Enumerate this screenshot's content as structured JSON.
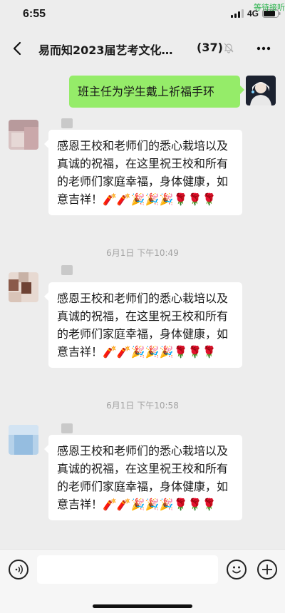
{
  "status_bar": {
    "time": "6:55",
    "network": "4G",
    "overlay_text": "等待接听"
  },
  "nav": {
    "back_icon": "chevron-left-icon",
    "title": "易而知2023届艺考文化…",
    "member_count": "(37)",
    "mute_icon": "bell-muted-icon",
    "more_icon": "more-dots-icon"
  },
  "messages": [
    {
      "type": "outgoing",
      "text": "班主任为学生戴上祈福手环"
    },
    {
      "type": "incoming",
      "text": "感恩王校和老师们的悉心栽培以及真诚的祝福，在这里祝王校和所有的老师们家庭幸福，身体健康，如意吉祥！🧨🧨🎉🎉🎉🌹🌹🌹"
    },
    {
      "type": "timestamp",
      "text": "6月1日 下午10:49"
    },
    {
      "type": "incoming",
      "text": "感恩王校和老师们的悉心栽培以及真诚的祝福，在这里祝王校和所有的老师们家庭幸福，身体健康，如意吉祥！🧨🧨🎉🎉🎉🌹🌹🌹"
    },
    {
      "type": "timestamp",
      "text": "6月1日 下午10:58"
    },
    {
      "type": "incoming",
      "text": "感恩王校和老师们的悉心栽培以及真诚的祝福，在这里祝王校和所有的老师们家庭幸福，身体健康，如意吉祥！🧨🧨🎉🎉🎉🌹🌹🌹"
    }
  ],
  "input_bar": {
    "voice_icon": "voice-icon",
    "emoji_icon": "emoji-icon",
    "plus_icon": "plus-icon",
    "placeholder": ""
  },
  "colors": {
    "background": "#ededed",
    "outgoing_bubble": "#95ec69",
    "incoming_bubble": "#ffffff",
    "overlay_green": "#2bb24c"
  }
}
